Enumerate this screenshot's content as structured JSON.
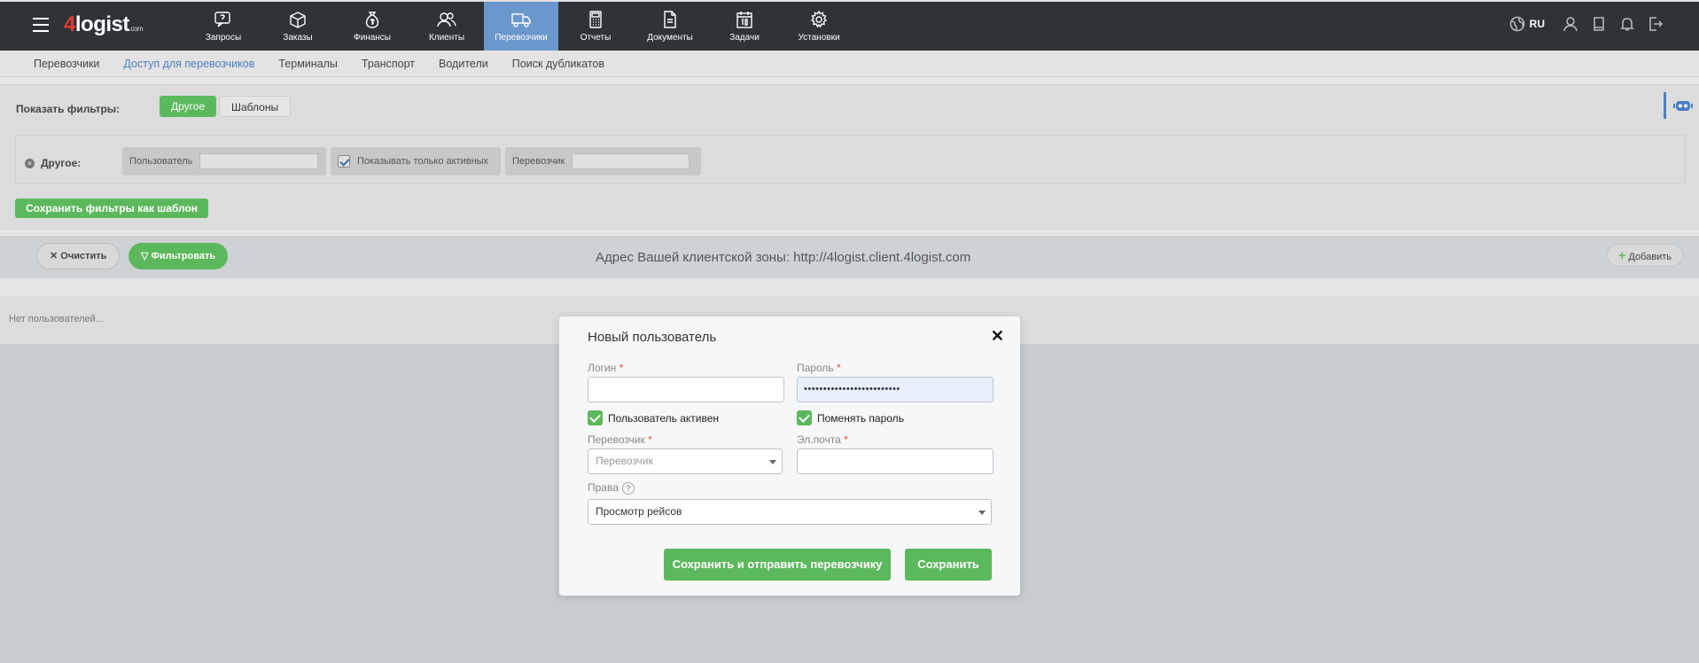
{
  "header": {
    "logo_digit": "4",
    "logo_text": "logist",
    "logo_suffix": ".com",
    "nav": [
      {
        "label": "Запросы",
        "icon": "chat-question-icon"
      },
      {
        "label": "Заказы",
        "icon": "box-icon"
      },
      {
        "label": "Финансы",
        "icon": "money-bag-icon"
      },
      {
        "label": "Клиенты",
        "icon": "users-icon"
      },
      {
        "label": "Перевозчики",
        "icon": "truck-icon",
        "active": true
      },
      {
        "label": "Отчеты",
        "icon": "calculator-icon"
      },
      {
        "label": "Документы",
        "icon": "document-icon"
      },
      {
        "label": "Задачи",
        "icon": "calendar-icon"
      },
      {
        "label": "Установки",
        "icon": "gear-icon"
      }
    ],
    "lang": "RU"
  },
  "subnav": {
    "items": [
      "Перевозчики",
      "Доступ для перевозчиков",
      "Терминалы",
      "Транспорт",
      "Водители",
      "Поиск дубликатов"
    ],
    "active_index": 1
  },
  "filters": {
    "show_label": "Показать фильтры:",
    "tab_other": "Другое",
    "tab_templates": "Шаблоны",
    "group_label": "Другое:",
    "user_label": "Пользователь",
    "only_active_label": "Показывать только активных",
    "carrier_label": "Перевозчик",
    "save_template": "Сохранить фильтры как шаблон"
  },
  "actions": {
    "clear": "Очистить",
    "filter": "Фильтровать",
    "client_zone": "Адрес Вашей клиентской зоны: http://4logist.client.4logist.com",
    "add": "Добавить"
  },
  "list": {
    "empty": "Нет пользователей..."
  },
  "modal": {
    "title": "Новый пользователь",
    "login_label": "Логин",
    "password_label": "Пароль",
    "password_value": "•••••••••••••••••••••••••",
    "user_active": "Пользователь активен",
    "change_password": "Поменять пароль",
    "carrier_label": "Перевозчик",
    "carrier_placeholder": "Перевозчик",
    "email_label": "Эл.почта",
    "rights_label": "Права",
    "rights_value": "Просмотр рейсов",
    "required_mark": "*",
    "help_mark": "?",
    "btn_save_send": "Сохранить и отправить перевозчику",
    "btn_save": "Сохранить",
    "close": "✕"
  },
  "colors": {
    "green": "#5cb85c",
    "nav_active": "#6a97cc",
    "topbar": "#2d3337",
    "link_active": "#4a7fc1",
    "required": "#d9534f"
  }
}
